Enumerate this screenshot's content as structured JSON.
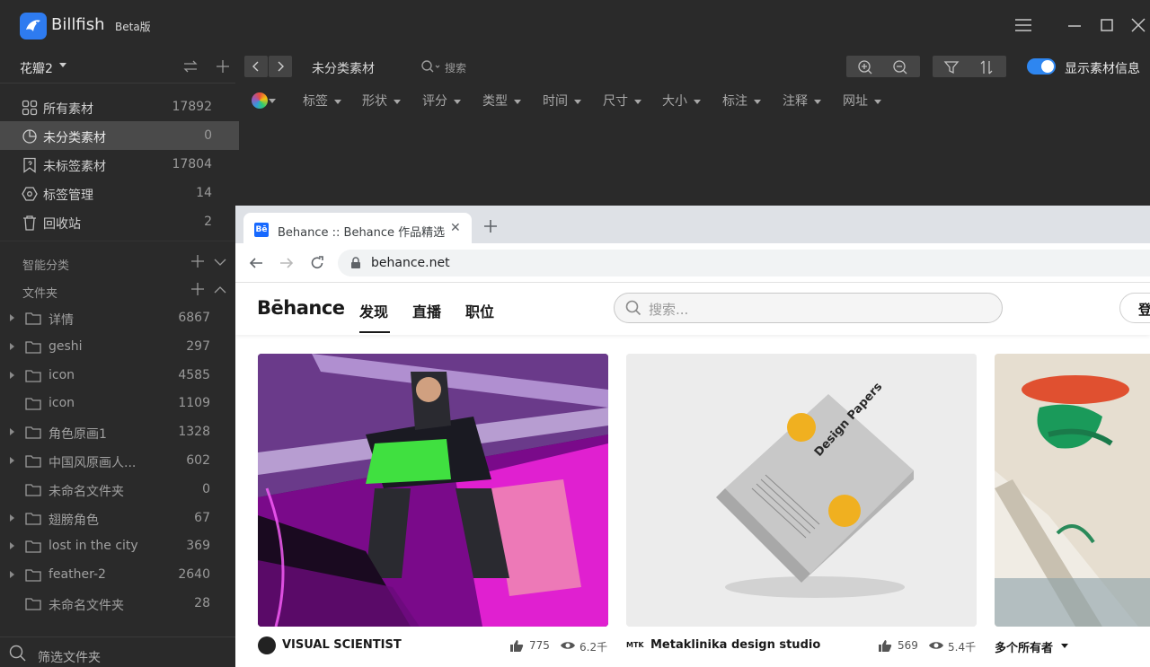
{
  "app": {
    "name": "Billfish",
    "beta": "Beta版"
  },
  "toolbar": {
    "library": "花瓣2",
    "current": "未分类素材",
    "search_placeholder": "搜索",
    "show_info": "显示素材信息"
  },
  "sidebar": {
    "items": [
      {
        "label": "所有素材",
        "count": "17892",
        "icon": "grid-icon"
      },
      {
        "label": "未分类素材",
        "count": "0",
        "icon": "pie-icon"
      },
      {
        "label": "未标签素材",
        "count": "17804",
        "icon": "bookmark-icon"
      },
      {
        "label": "标签管理",
        "count": "14",
        "icon": "hexagon-icon"
      },
      {
        "label": "回收站",
        "count": "2",
        "icon": "trash-icon"
      }
    ],
    "smart_label": "智能分类",
    "folders_label": "文件夹",
    "folders": [
      {
        "label": "详情",
        "count": "6867",
        "has_children": true
      },
      {
        "label": "geshi",
        "count": "297",
        "has_children": true
      },
      {
        "label": "icon",
        "count": "4585",
        "has_children": true
      },
      {
        "label": "icon",
        "count": "1109",
        "has_children": false
      },
      {
        "label": "角色原画1",
        "count": "1328",
        "has_children": true
      },
      {
        "label": "中国风原画人...",
        "count": "602",
        "has_children": true
      },
      {
        "label": "未命名文件夹",
        "count": "0",
        "has_children": false
      },
      {
        "label": "翅膀角色",
        "count": "67",
        "has_children": true
      },
      {
        "label": "lost in the city",
        "count": "369",
        "has_children": true
      },
      {
        "label": "feather-2",
        "count": "2640",
        "has_children": true
      },
      {
        "label": "未命名文件夹",
        "count": "28",
        "has_children": false
      }
    ],
    "filter_folders": "筛选文件夹"
  },
  "filters": [
    "标签",
    "形状",
    "评分",
    "类型",
    "时间",
    "尺寸",
    "大小",
    "标注",
    "注释",
    "网址"
  ],
  "browser": {
    "tab_title": "Behance :: Behance 作品精选",
    "favicon": "Bē",
    "url": "behance.net"
  },
  "behance": {
    "logo": "Bēhance",
    "nav": [
      "发现",
      "直播",
      "职位"
    ],
    "search_placeholder": "搜索...",
    "login": "登录",
    "cards": [
      {
        "owner": "VISUAL SCIENTIST",
        "likes": "775",
        "views": "6.2千"
      },
      {
        "owner": "Metaklinika design studio",
        "owner_badge": "MTK",
        "likes": "569",
        "views": "5.4千"
      },
      {
        "owner": "多个所有者"
      }
    ],
    "card2_title": "Design Papers"
  }
}
